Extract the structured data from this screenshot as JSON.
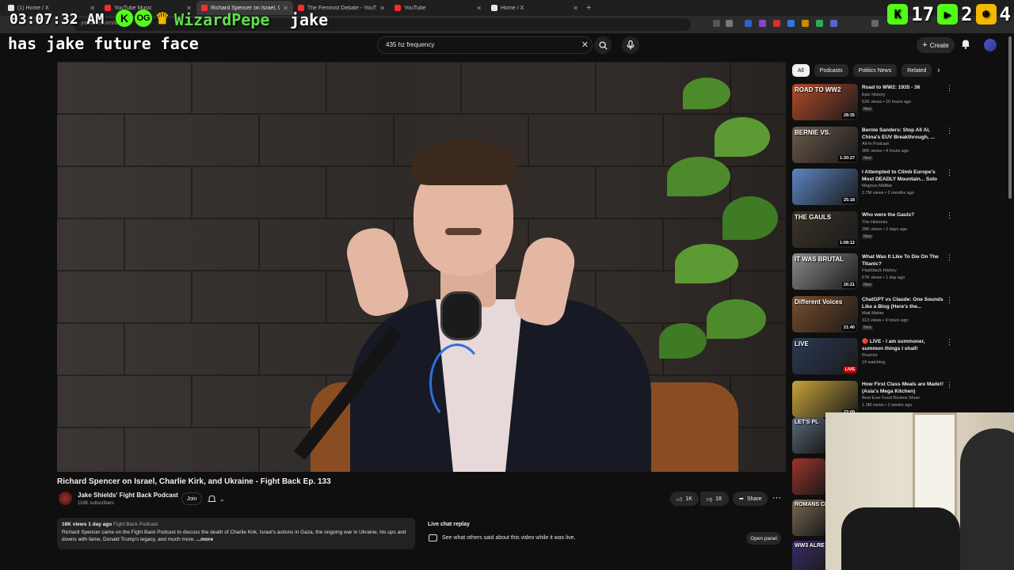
{
  "browser": {
    "tabs": [
      {
        "title": "(1) Home / X",
        "favicon_color": "#e7e7e7",
        "active": false
      },
      {
        "title": "YouTube Music",
        "favicon_color": "#ff2a2a",
        "active": false
      },
      {
        "title": "Richard Spencer on Israel, C",
        "favicon_color": "#ff2a2a",
        "active": true
      },
      {
        "title": "The Feminist Debate - YouTube",
        "favicon_color": "#ff2a2a",
        "active": false
      },
      {
        "title": "YouTube",
        "favicon_color": "#ff2a2a",
        "active": false
      },
      {
        "title": "Home / X",
        "favicon_color": "#e7e7e7",
        "active": false
      }
    ],
    "address": "youtube.com/watch"
  },
  "overlay": {
    "clock": "03:07:32 AM",
    "username": "WizardPepe",
    "message_part1": "jake",
    "message_part2": "has jake future face",
    "stats": {
      "count1": "17",
      "count2": "2",
      "count3": "4"
    },
    "colors": {
      "kick_green": "#53fc18",
      "crown_gold": "#f5b700",
      "name_green": "#5ee04a"
    }
  },
  "youtube": {
    "search": {
      "value": "435 hz frequency"
    },
    "create_label": "Create",
    "video": {
      "title": "Richard Spencer on Israel, Charlie Kirk, and Ukraine - Fight Back Ep. 133",
      "channel": "Jake Shields' Fight Back Podcast",
      "subscribers": "116K subscribers",
      "join_label": "Join",
      "likes": "1K",
      "dislikes": "18",
      "share_label": "Share"
    },
    "description": {
      "meta": "16K views  1 day ago",
      "category": "Fight Back Podcast",
      "text": "Richard Spencer came on the Fight Back Podcast to discuss the death of Charlie Kirk, Israel's actions in Gaza, the ongoing war in Ukraine, his ups and downs with fame, Donald Trump's legacy, and much more.",
      "more": "...more"
    },
    "live_chat": {
      "title": "Live chat replay",
      "text": "See what others said about this video while it was live.",
      "open_label": "Open panel"
    },
    "chips": [
      "All",
      "Podcasts",
      "Politics News",
      "Related"
    ],
    "recommendations": [
      {
        "title": "Road to WW2: 1935 - 36",
        "channel": "Epic History",
        "views": "52K views • 10 hours ago",
        "badge": "New",
        "duration": "28:35",
        "thumb_label": "ROAD TO WW2",
        "thumb_color": "#b34a2a"
      },
      {
        "title": "Bernie Sanders: Stop All AI, China's EUV Breakthrough, ...",
        "channel": "All-In Podcast",
        "views": "36K views • 4 hours ago",
        "badge": "New",
        "duration": "1:30:27",
        "thumb_label": "BERNIE VS.",
        "thumb_color": "#6b5a4a"
      },
      {
        "title": "I Attempted to Climb Europe's Most DEADLY Mountain... Solo",
        "channel": "Magnus Midtbø",
        "views": "2.7M views • 2 months ago",
        "badge": "",
        "duration": "25:18",
        "thumb_label": "",
        "thumb_color": "#5c86c4"
      },
      {
        "title": "Who were the Gauls?",
        "channel": "The Histories",
        "views": "28K views • 2 days ago",
        "badge": "New",
        "duration": "1:08:12",
        "thumb_label": "THE GAULS",
        "thumb_color": "#3c3428"
      },
      {
        "title": "What Was It Like To Die On The Titanic?",
        "channel": "Flashback History",
        "views": "67K views • 1 day ago",
        "badge": "New",
        "duration": "26:21",
        "thumb_label": "IT WAS BRUTAL",
        "thumb_color": "#8a8a8a"
      },
      {
        "title": "ChatGPT vs Claude: One Sounds Like a Blog (Here's the...",
        "channel": "Matt Maher",
        "views": "313 views • 4 hours ago",
        "badge": "New",
        "duration": "21:40",
        "thumb_label": "Different Voices",
        "thumb_color": "#7a4d2c"
      },
      {
        "title": "🔴 LIVE - I am summoner, summon things I shall!",
        "channel": "Roarrior",
        "views": "19 watching",
        "badge": "",
        "duration": "LIVE",
        "thumb_label": "LIVE",
        "thumb_color": "#2b3a55"
      },
      {
        "title": "How First Class Meals are Made!! (Asia's Mega Kitchen)",
        "channel": "Best Ever Food Review Show",
        "views": "1.3M views • 2 weeks ago",
        "badge": "",
        "duration": "22:09",
        "thumb_label": "",
        "thumb_color": "#c9a33a"
      }
    ],
    "extra_thumbs": [
      {
        "label": "LET'S PL",
        "color": "#5a6a7a"
      },
      {
        "label": "",
        "color": "#a0342c"
      },
      {
        "label": "ROMANS CHAN",
        "color": "#7c6a52"
      },
      {
        "label": "WW3 ALRE",
        "color": "#3a2a6a"
      }
    ]
  }
}
